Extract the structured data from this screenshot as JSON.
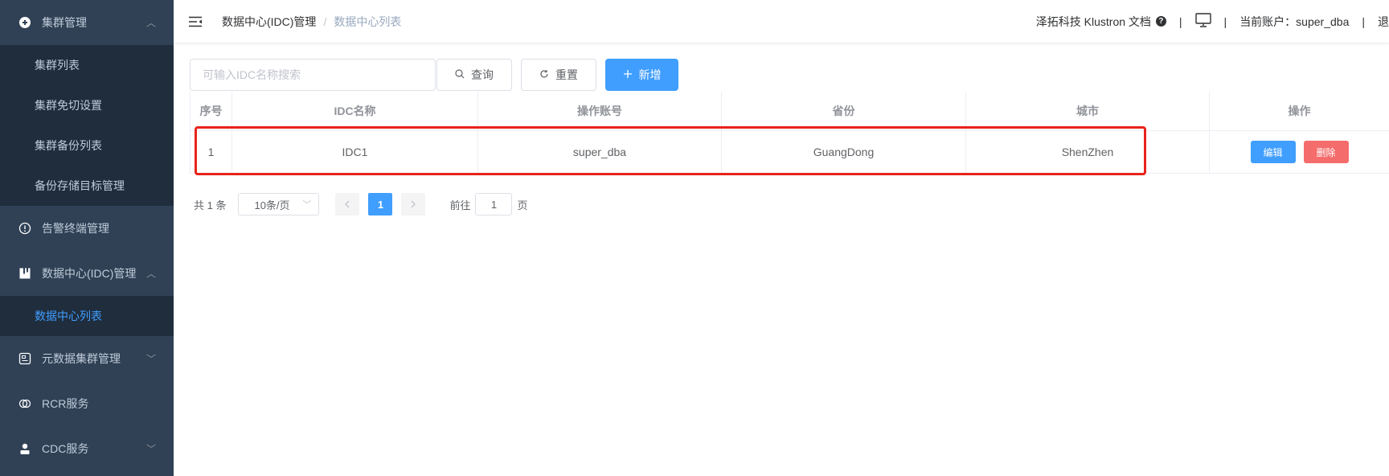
{
  "sidebar": {
    "items": [
      {
        "label": "集群管理",
        "icon": "cluster-icon",
        "expanded": true
      },
      {
        "label": "集群列表"
      },
      {
        "label": "集群免切设置"
      },
      {
        "label": "集群备份列表"
      },
      {
        "label": "备份存储目标管理"
      },
      {
        "label": "告警终端管理",
        "icon": "alert-icon"
      },
      {
        "label": "数据中心(IDC)管理",
        "icon": "datacenter-icon",
        "expanded": true
      },
      {
        "label": "数据中心列表",
        "active": true
      },
      {
        "label": "元数据集群管理",
        "icon": "metadata-icon",
        "expanded": false
      },
      {
        "label": "RCR服务",
        "icon": "rcr-icon"
      },
      {
        "label": "CDC服务",
        "icon": "cdc-icon",
        "expanded": false
      }
    ]
  },
  "header": {
    "breadcrumb": [
      "数据中心(IDC)管理",
      "数据中心列表"
    ],
    "docs_link": "泽拓科技 Klustron 文档",
    "account_label": "当前账户：super_dba",
    "logout_partial": "退"
  },
  "toolbar": {
    "search_placeholder": "可输入IDC名称搜索",
    "query_label": "查询",
    "reset_label": "重置",
    "add_label": "新增"
  },
  "table": {
    "columns": [
      "序号",
      "IDC名称",
      "操作账号",
      "省份",
      "城市",
      "操作"
    ],
    "rows": [
      {
        "index": "1",
        "name": "IDC1",
        "account": "super_dba",
        "province": "GuangDong",
        "city": "ShenZhen"
      }
    ],
    "edit_label": "编辑",
    "delete_label": "删除"
  },
  "pagination": {
    "total": "共 1 条",
    "page_size": "10条/页",
    "current_page": "1",
    "goto_prefix": "前往",
    "goto_value": "1",
    "goto_suffix": "页"
  },
  "colors": {
    "sidebar_bg": "#304156",
    "submenu_bg": "#1f2d3d",
    "primary": "#409eff",
    "danger": "#f56c6c",
    "highlight": "#e8231a"
  }
}
